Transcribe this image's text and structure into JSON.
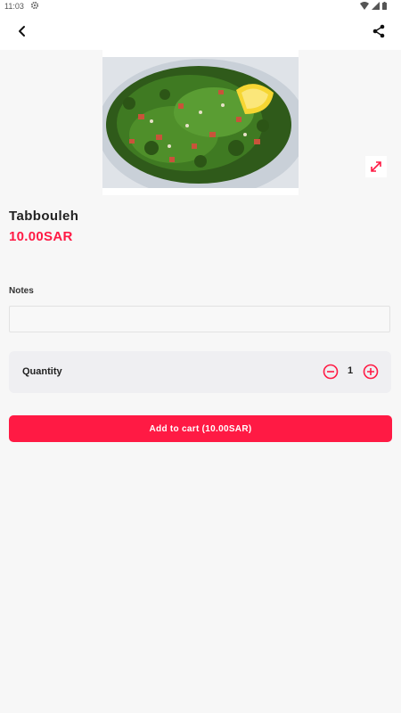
{
  "status_bar": {
    "time": "11:03"
  },
  "product": {
    "name": "Tabbouleh",
    "price": "10.00SAR"
  },
  "notes": {
    "label": "Notes",
    "value": "",
    "placeholder": ""
  },
  "quantity": {
    "label": "Quantity",
    "value": "1"
  },
  "cart": {
    "button_label": "Add to cart (10.00SAR)"
  },
  "colors": {
    "accent": "#ff1a44",
    "background": "#f7f7f7",
    "card": "#efeff2"
  },
  "icons": [
    "settings-icon",
    "wifi-icon",
    "signal-icon",
    "battery-icon",
    "back-arrow-icon",
    "share-icon",
    "expand-icon",
    "minus-circle-icon",
    "plus-circle-icon"
  ]
}
